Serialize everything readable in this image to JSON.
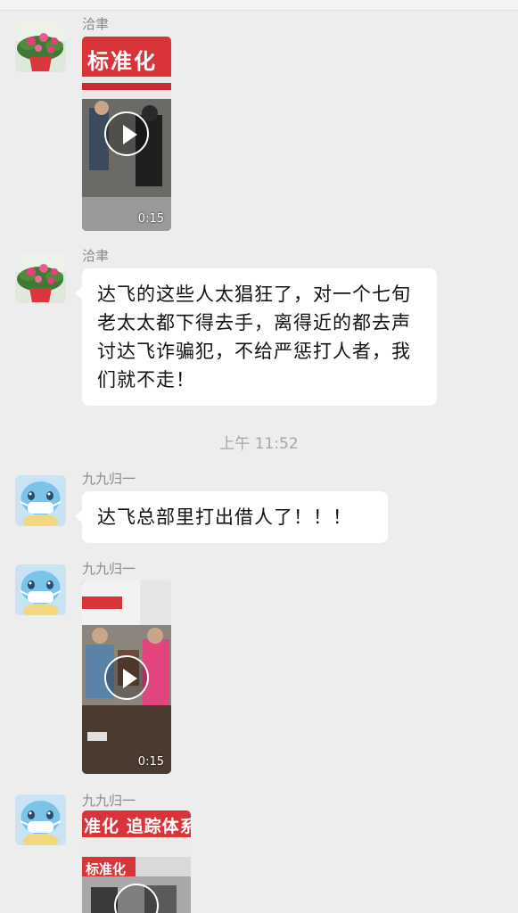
{
  "messages": [
    {
      "sender": "洽聿",
      "type": "video",
      "duration": "0:15"
    },
    {
      "sender": "洽聿",
      "type": "text",
      "text": "达飞的这些人太猖狂了，对一个七旬老太太都下得去手，离得近的都去声讨达飞诈骗犯，不给严惩打人者，我们就不走！"
    },
    {
      "time": "上午 11:52"
    },
    {
      "sender": "九九归一",
      "type": "text",
      "text": "达飞总部里打出借人了！！！"
    },
    {
      "sender": "九九归一",
      "type": "video",
      "duration": "0:15"
    },
    {
      "sender": "九九归一",
      "type": "video",
      "duration": ""
    }
  ],
  "video_captions": {
    "v1_banner": "标准化",
    "v3_banner": "准化 追踪体系",
    "v3_banner2": "标准化"
  },
  "icons": [
    "play-icon",
    "flower-avatar",
    "cartoon-avatar"
  ],
  "colors": {
    "background": "#ededed",
    "bubble": "#ffffff",
    "timestamp": "#a6a6a6"
  }
}
